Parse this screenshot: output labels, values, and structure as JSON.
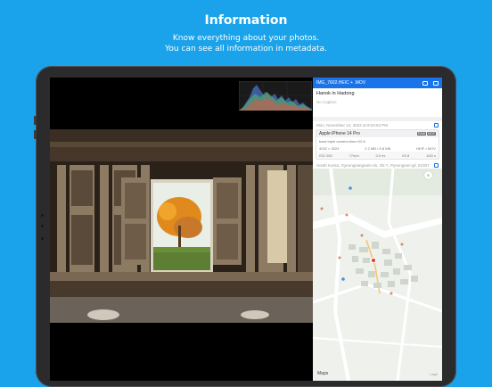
{
  "hero": {
    "title": "Information",
    "subtitle_line1": "Know everything about your photos.",
    "subtitle_line2": "You can see all information in metadata."
  },
  "panel": {
    "filename": "IMG_7602.HEIC + .MOV",
    "caption_title": "Hanok in Hadong",
    "caption_placeholder": "No Caption",
    "date": "Mon, November 14, 2022 at 9:03:53 PM",
    "camera": {
      "name": "Apple iPhone 14 Pro",
      "badges": [
        "RAW",
        "HEIF"
      ],
      "lens": "back triple camera 6mm f/2.8",
      "resolution": "4032 × 3024",
      "size": "2.2 MB • 5.8 MB",
      "format": "HEIF • MOV",
      "specs": [
        "ISO 250",
        "77mm",
        "0.0 ev",
        "f/2.8",
        "1/60 s"
      ]
    },
    "address": "South Korea, Gyeongsangnam-do, Ok-7, Pyeongsari-gil, 52307",
    "map": {
      "compass": "S",
      "logo": "Maps",
      "legal": "Legal"
    }
  },
  "colors": {
    "background": "#1aa3ea",
    "toolbar": "#1a73e8",
    "pin": "#e53935"
  }
}
